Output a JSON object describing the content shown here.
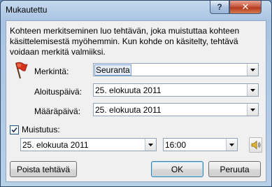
{
  "window": {
    "title": "Mukautettu",
    "help_label": "?",
    "close_label": "✕"
  },
  "description": "Kohteen merkitseminen luo tehtävän, joka muistuttaa kohteen käsittelemisestä myöhemmin. Kun kohde on käsitelty, tehtävä voidaan merkitä valmiiksi.",
  "form": {
    "flag_label": "Merkintä:",
    "flag_value": "Seuranta",
    "start_label": "Aloituspäivä:",
    "start_value": "25. elokuuta 2011",
    "due_label": "Määräpäivä:",
    "due_value": "25. elokuuta 2011"
  },
  "reminder": {
    "checkbox_label": "Muistutus:",
    "checked": true,
    "date_value": "25. elokuuta 2011",
    "time_value": "16:00"
  },
  "buttons": {
    "clear_label": "Poista tehtävä",
    "ok_label": "OK",
    "cancel_label": "Peruuta"
  },
  "colors": {
    "flag_red": "#d8321f",
    "title_bar": "#a9c4e2",
    "close_red": "#c85a41"
  },
  "icons": {
    "flag": "flag-icon",
    "dropdown": "chevron-down-icon",
    "sound": "speaker-icon",
    "check": "checkmark-icon"
  }
}
